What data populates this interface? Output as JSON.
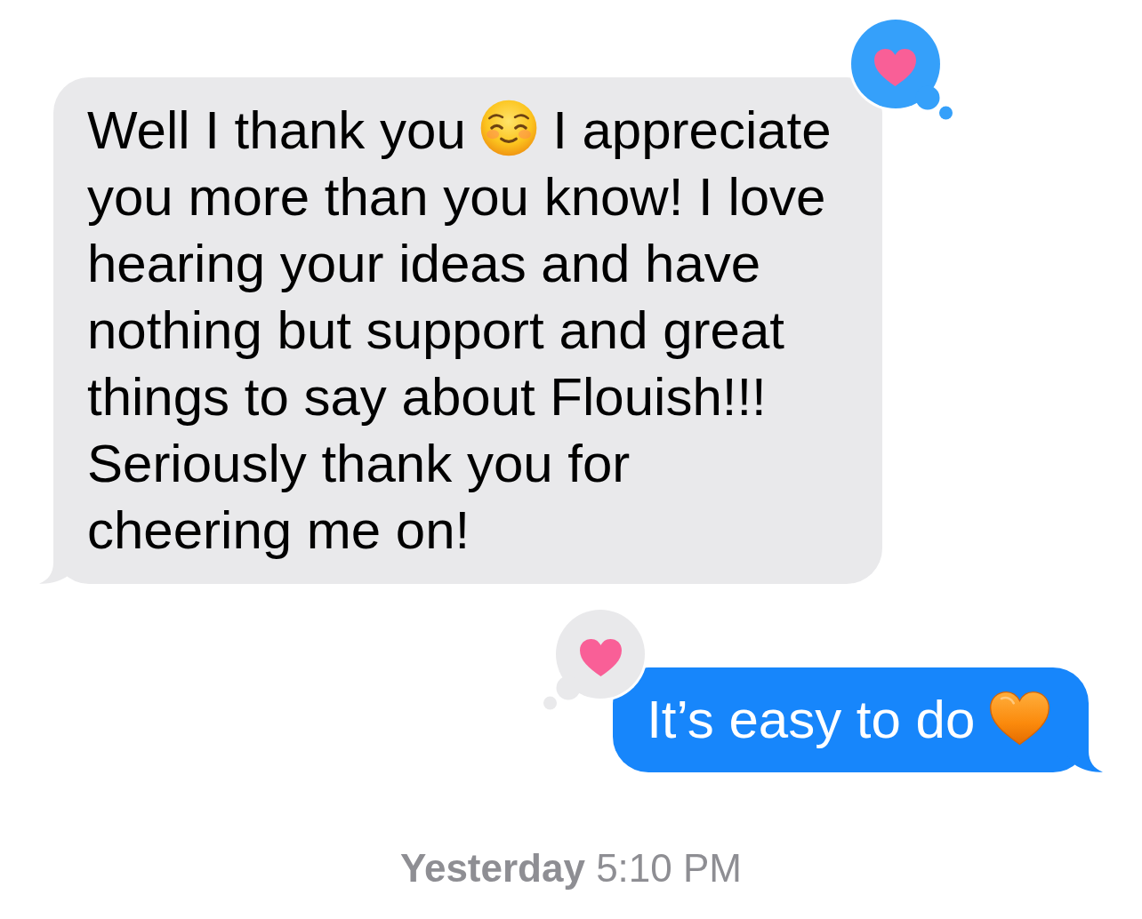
{
  "messages": [
    {
      "sent": false,
      "segments": [
        {
          "kind": "text",
          "text": "Well I thank you"
        },
        {
          "kind": "smiley"
        },
        {
          "kind": "text",
          "text": "I appreciate you more than you know! I love hearing your ideas and have nothing but support and great things to say about Flouish!!! Seriously thank you for cheering me on!"
        }
      ],
      "reaction": {
        "mine": true
      }
    },
    {
      "sent": true,
      "segments": [
        {
          "kind": "text",
          "text": "It’s easy to do"
        },
        {
          "kind": "heart"
        }
      ],
      "reaction": {
        "mine": false
      }
    }
  ],
  "timestamp": "**Yesterday** 5:10 PM"
}
